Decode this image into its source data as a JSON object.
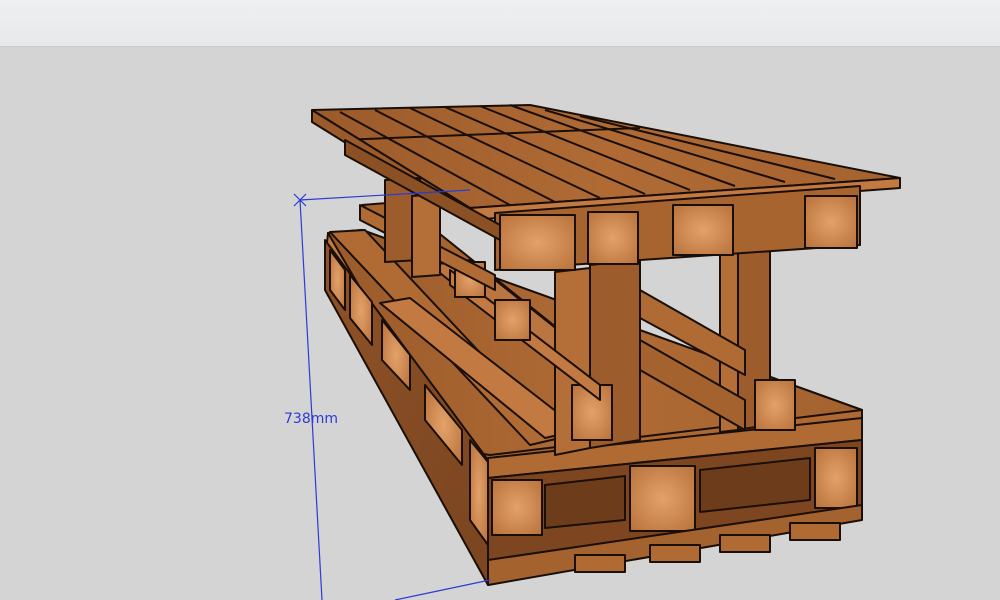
{
  "viewport": {
    "dimension": {
      "text": "738mm"
    }
  },
  "colors": {
    "background": "#d4d4d4",
    "toolbar": "#e9ebed",
    "wood_light": "#d08a52",
    "wood_mid": "#b56f38",
    "wood_dark": "#8b5124",
    "edge": "#1a0f06",
    "dimension": "#2b3bd6"
  },
  "icons": {
    "model": "pallet-table-model",
    "dimension": "dimension-line"
  }
}
